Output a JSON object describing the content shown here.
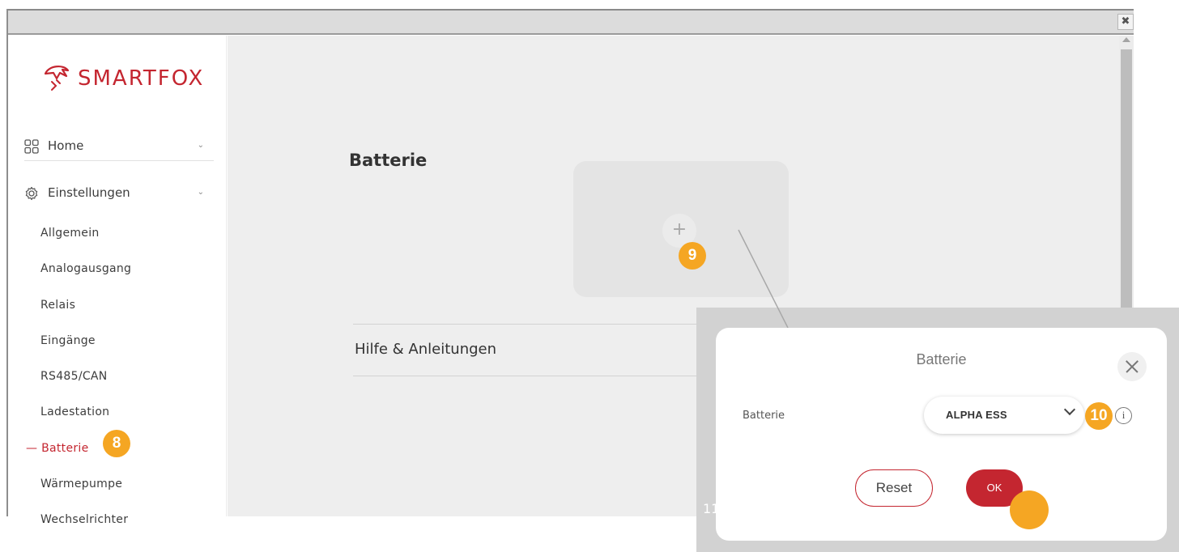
{
  "window": {
    "close_glyph": "✖"
  },
  "brand": {
    "name": "SMARTFOX",
    "color": "#c42630",
    "icon": "fox-logo-icon"
  },
  "nav": {
    "home": {
      "label": "Home",
      "icon": "grid-icon"
    },
    "settings": {
      "label": "Einstellungen",
      "icon": "gear-icon"
    },
    "sub_items": [
      {
        "label": "Allgemein"
      },
      {
        "label": "Analogausgang"
      },
      {
        "label": "Relais"
      },
      {
        "label": "Eingänge"
      },
      {
        "label": "RS485/CAN"
      },
      {
        "label": "Ladestation"
      },
      {
        "label": "Batterie",
        "active": true
      },
      {
        "label": "Wärmepumpe"
      },
      {
        "label": "Wechselrichter"
      }
    ],
    "active_prefix": "—"
  },
  "main": {
    "heading": "Batterie",
    "add_symbol": "+",
    "help_label": "Hilfe & Anleitungen"
  },
  "dialog": {
    "title": "Batterie",
    "field_label": "Batterie",
    "selected": "ALPHA ESS",
    "info_glyph": "i",
    "reset_label": "Reset",
    "ok_label": "OK"
  },
  "callouts": {
    "c8": "8",
    "c9": "9",
    "c10": "10",
    "c11_partial": "11"
  },
  "colors": {
    "accent": "#c42630",
    "callout": "#f5a623"
  }
}
